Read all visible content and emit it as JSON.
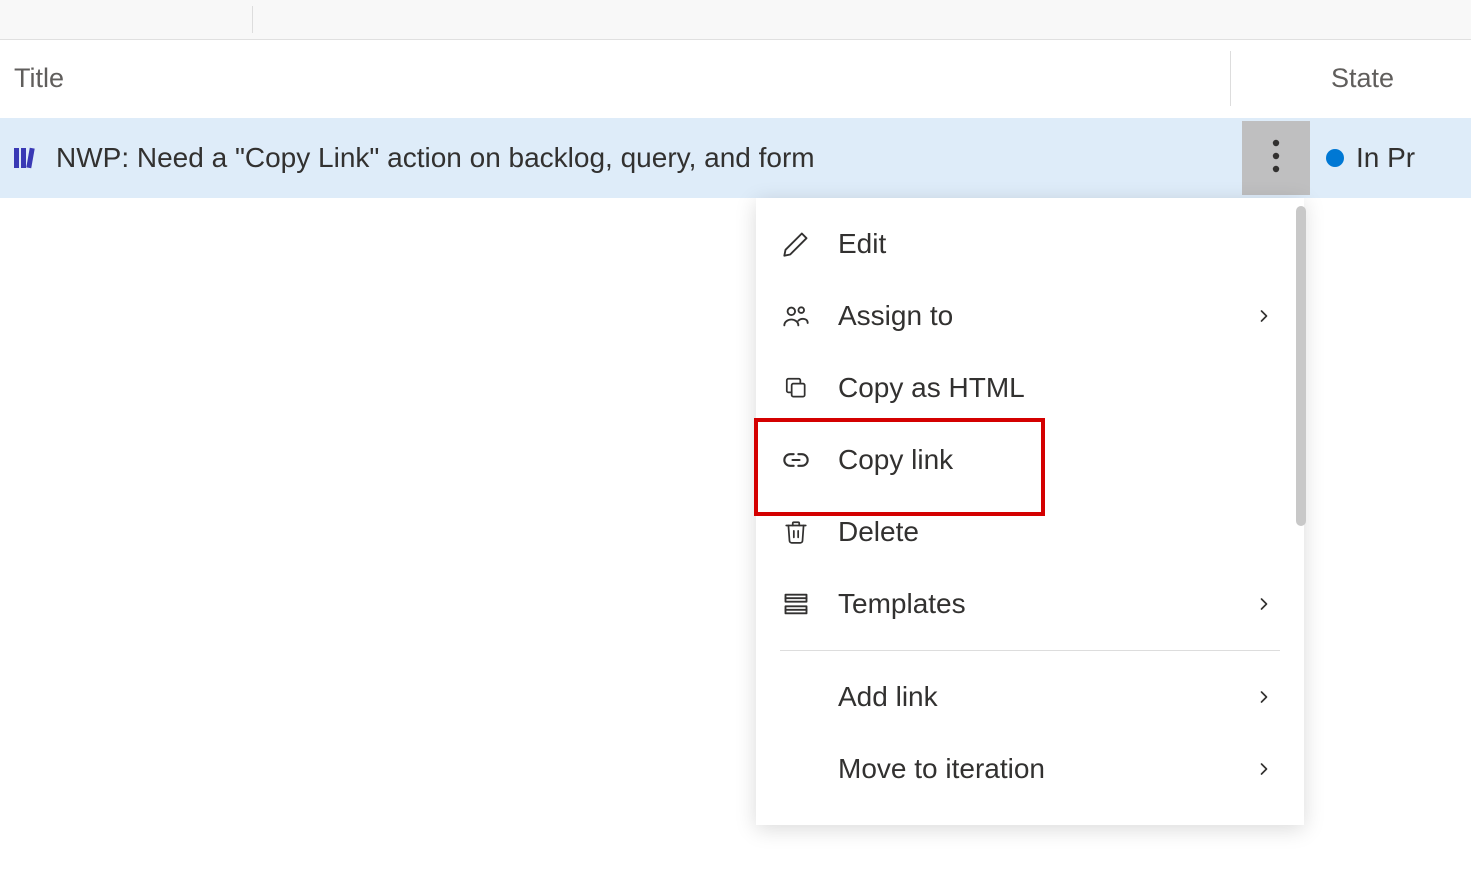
{
  "columns": {
    "title": "Title",
    "state": "State"
  },
  "row": {
    "title": "NWP: Need a \"Copy Link\" action on backlog, query, and form",
    "state": "In Pr",
    "state_color": "#0078d4"
  },
  "menu": {
    "edit": "Edit",
    "assign_to": "Assign to",
    "copy_html": "Copy as HTML",
    "copy_link": "Copy link",
    "delete": "Delete",
    "templates": "Templates",
    "add_link": "Add link",
    "move_iteration": "Move to iteration"
  },
  "highlight": {
    "target": "copy_link"
  }
}
